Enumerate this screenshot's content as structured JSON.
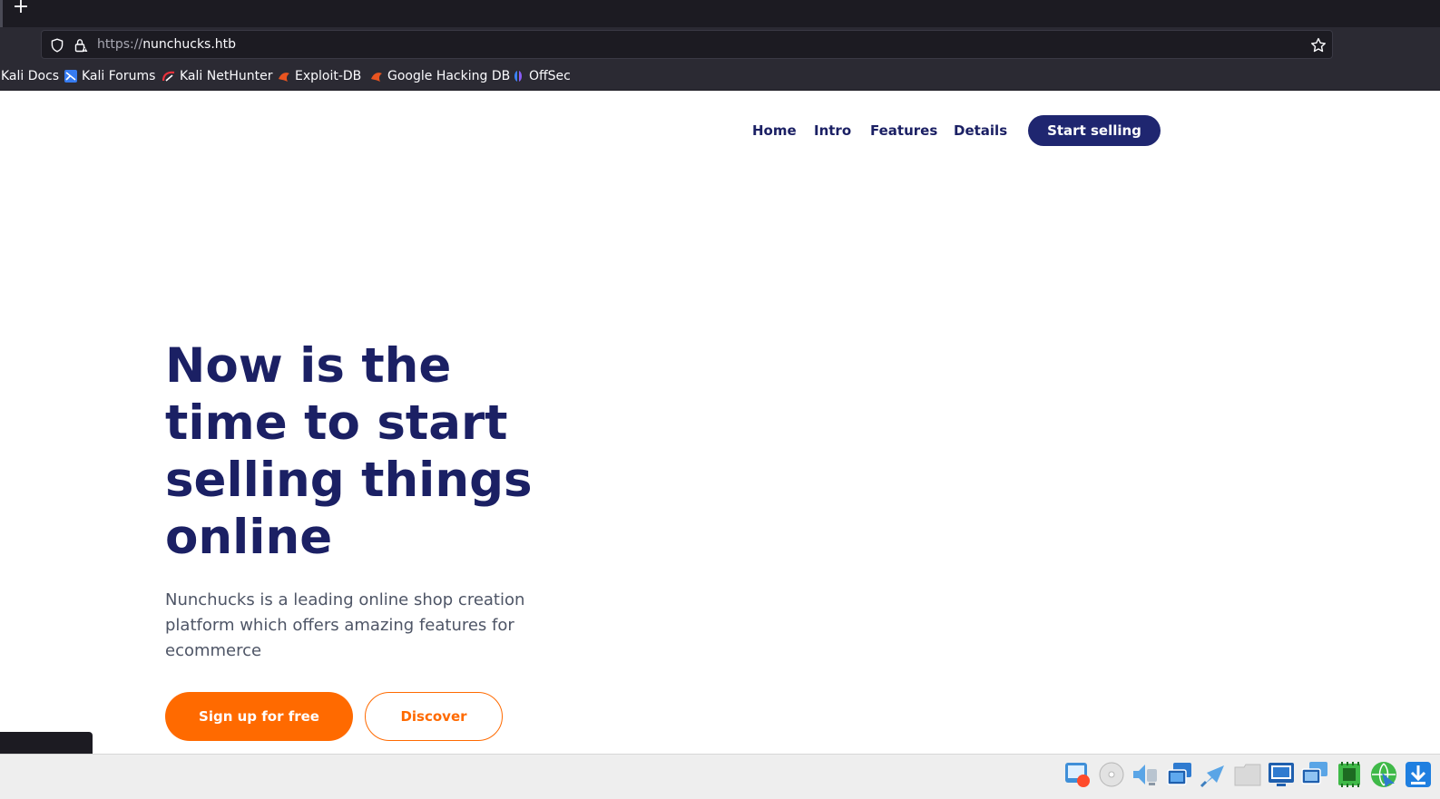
{
  "browser": {
    "new_tab_label": "+",
    "url_scheme": "https://",
    "url_host": "nunchucks.htb",
    "bookmarks": [
      {
        "label": "Kali Docs",
        "icon": "kali-docs-icon"
      },
      {
        "label": "Kali Forums",
        "icon": "kali-forums-icon"
      },
      {
        "label": "Kali NetHunter",
        "icon": "kali-nethunter-icon"
      },
      {
        "label": "Exploit-DB",
        "icon": "exploit-db-icon"
      },
      {
        "label": "Google Hacking DB",
        "icon": "google-hacking-db-icon"
      },
      {
        "label": "OffSec",
        "icon": "offsec-icon"
      }
    ]
  },
  "site": {
    "nav": {
      "home": "Home",
      "intro": "Intro",
      "features": "Features",
      "details": "Details",
      "cta": "Start selling"
    },
    "hero": {
      "title": "Now is the time to start selling things online",
      "subtitle": "Nunchucks is a leading online shop creation platform which offers amazing features for ecommerce",
      "primary_button": "Sign up for free",
      "secondary_button": "Discover"
    }
  },
  "colors": {
    "brand_navy": "#1b2064",
    "brand_orange": "#ff6a00"
  },
  "status_icons": [
    "record-icon",
    "optical-drive-icon",
    "audio-icon",
    "network-icon",
    "usb-icon",
    "shared-folder-icon",
    "display-icon",
    "screen-capture-icon",
    "cpu-icon",
    "mouse-integration-icon",
    "download-icon"
  ]
}
